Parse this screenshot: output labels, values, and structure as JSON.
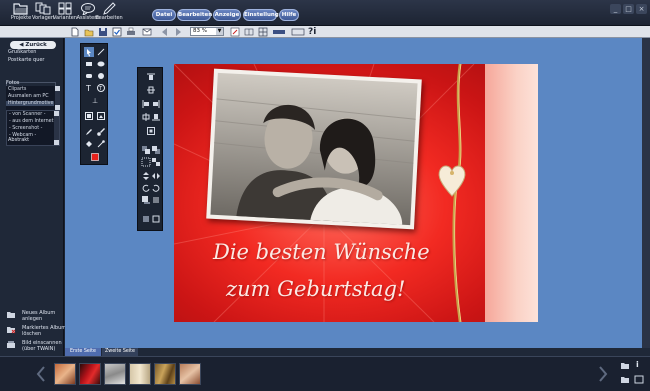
{
  "topbar": {
    "buttons": [
      {
        "label": "Projekte",
        "icon": "folder-open-icon"
      },
      {
        "label": "Vorlagen",
        "icon": "templates-icon"
      },
      {
        "label": "Varianten",
        "icon": "variants-grid-icon"
      },
      {
        "label": "Assistent",
        "icon": "assistant-speech-icon"
      },
      {
        "label": "Bearbeiten",
        "icon": "pencil-icon"
      }
    ],
    "menus": [
      "Datei",
      "Bearbeiten",
      "Anzeige",
      "Einstellungen",
      "Hilfe"
    ],
    "window_controls": [
      "_",
      "□",
      "×"
    ]
  },
  "toolbar2": {
    "zoom_value": "83 %",
    "zoom_arrow": "▼",
    "help_label": "?i"
  },
  "leftpanel": {
    "back_label": "Zurück",
    "category_items": [
      "Grußkarten",
      "Postkarte quer"
    ],
    "fotos_header": "Fotos",
    "fotos_items": [
      "Cliparts",
      "Ausmalen am PC",
      "Hintergrundmotive"
    ],
    "source_items": [
      "- von Scanner -",
      "- aus dem Internet -",
      "- Screenshot -",
      "- Webcam -",
      "Abstrakt"
    ],
    "actions": [
      {
        "label": "Neues Album anlegen",
        "icon": "new-album-icon"
      },
      {
        "label": "Markiertes Album löschen",
        "icon": "delete-album-icon"
      },
      {
        "label": "Bild einscannen (über TWAIN)",
        "icon": "scan-icon"
      }
    ]
  },
  "card": {
    "greeting_line1": "Die besten Wünsche",
    "greeting_line2": "zum Geburtstag!"
  },
  "tabs": [
    "Erste Seite",
    "Zweite Seite"
  ],
  "colors": {
    "workspace": "#5b87c3",
    "panel": "#1f2838",
    "card_red": "#e8221c",
    "accent_blue": "#4f6cae"
  }
}
